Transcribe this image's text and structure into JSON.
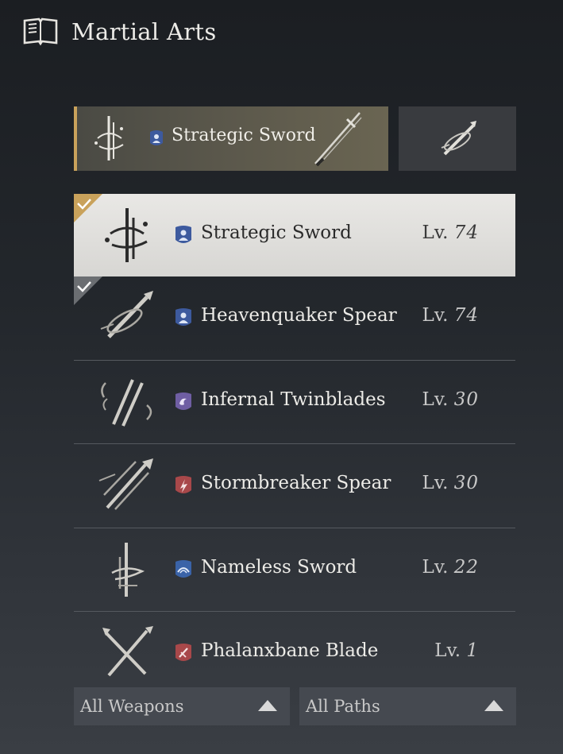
{
  "header": {
    "title": "Martial Arts",
    "icon": "book-icon"
  },
  "equipped": {
    "name": "Strategic Sword",
    "path_icon": "blue-path-icon",
    "accent": "#c9a25b"
  },
  "list": [
    {
      "name": "Strategic Sword",
      "level_prefix": "Lv.",
      "level": "74",
      "path_color": "#3d5a9e",
      "selected": true,
      "checked": true
    },
    {
      "name": "Heavenquaker Spear",
      "level_prefix": "Lv.",
      "level": "74",
      "path_color": "#3d5a9e",
      "selected": false,
      "checked": true
    },
    {
      "name": "Infernal Twinblades",
      "level_prefix": "Lv.",
      "level": "30",
      "path_color": "#6f5ea3",
      "selected": false,
      "checked": false
    },
    {
      "name": "Stormbreaker Spear",
      "level_prefix": "Lv.",
      "level": "30",
      "path_color": "#a8484a",
      "selected": false,
      "checked": false
    },
    {
      "name": "Nameless Sword",
      "level_prefix": "Lv.",
      "level": "22",
      "path_color": "#3a63a8",
      "selected": false,
      "checked": false
    },
    {
      "name": "Phalanxbane Blade",
      "level_prefix": "Lv.",
      "level": "1",
      "path_color": "#a8484a",
      "selected": false,
      "checked": false
    }
  ],
  "filters": {
    "weapons": "All Weapons",
    "paths": "All Paths"
  }
}
